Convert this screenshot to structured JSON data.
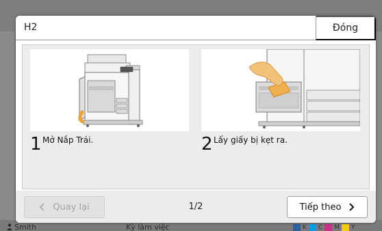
{
  "dialog": {
    "title": "H2",
    "close_label": "Đóng",
    "steps": [
      {
        "number": "1",
        "text": "Mở Nắp Trái."
      },
      {
        "number": "2",
        "text": "Lấy giấy bị kẹt ra."
      }
    ],
    "back_label": "Quay lại",
    "next_label": "Tiếp theo",
    "page_indicator": "1/2"
  },
  "background": {
    "user_name": "Smith",
    "job_label": "Kỳ làm việc",
    "swatch_labels": [
      "K",
      "C",
      "M",
      "Y"
    ]
  },
  "colors": {
    "accent_orange": "#f0a030",
    "disabled_text": "#a4a4a4",
    "swatch_k": "#333333",
    "swatch_c": "#00a0e0",
    "swatch_m": "#d0308a",
    "swatch_y": "#f2d000"
  }
}
